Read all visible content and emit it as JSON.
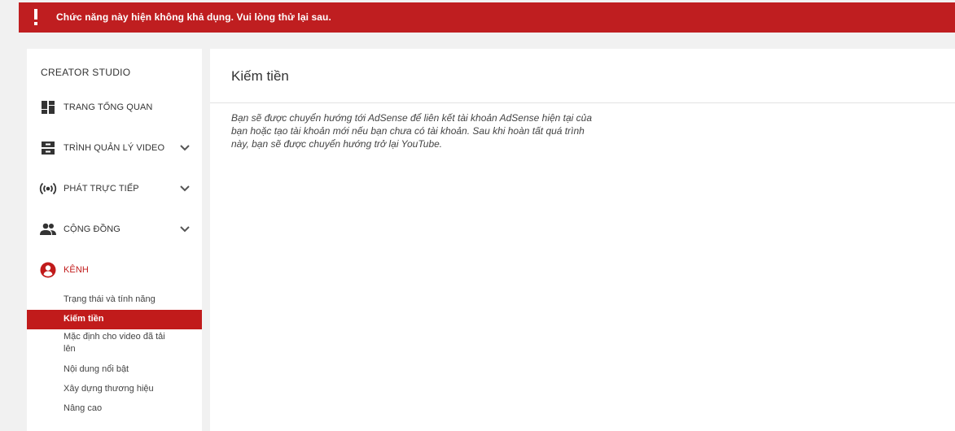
{
  "banner": {
    "message": "Chức năng này hiện không khả dụng. Vui lòng thử lại sau.",
    "icon": "exclamation-icon",
    "color": "#bf1e20"
  },
  "sidebar": {
    "title": "CREATOR STUDIO",
    "items": [
      {
        "label": "TRANG TỔNG QUAN",
        "icon": "dashboard-icon",
        "expandable": false
      },
      {
        "label": "TRÌNH QUẢN LÝ VIDEO",
        "icon": "video-manager-icon",
        "expandable": true
      },
      {
        "label": "PHÁT TRỰC TIẾP",
        "icon": "live-stream-icon",
        "expandable": true
      },
      {
        "label": "CỘNG ĐỒNG",
        "icon": "community-icon",
        "expandable": true
      },
      {
        "label": "KÊNH",
        "icon": "channel-icon",
        "expandable": false,
        "active": true
      }
    ],
    "sub_items": [
      {
        "label": "Trạng thái và tính năng"
      },
      {
        "label": "Kiếm tiền",
        "active": true
      },
      {
        "label": "Mặc định cho video đã tải lên"
      },
      {
        "label": "Nội dung nổi bật"
      },
      {
        "label": "Xây dựng thương hiệu"
      },
      {
        "label": "Nâng cao"
      }
    ],
    "accent_color": "#c11b1b"
  },
  "main": {
    "title": "Kiếm tiền",
    "description": "Bạn sẽ được chuyển hướng tới AdSense để liên kết tài khoản AdSense hiện tại của bạn hoặc tạo tài khoản mới nếu bạn chưa có tài khoản. Sau khi hoàn tất quá trình này, bạn sẽ được chuyển hướng trở lại YouTube."
  }
}
